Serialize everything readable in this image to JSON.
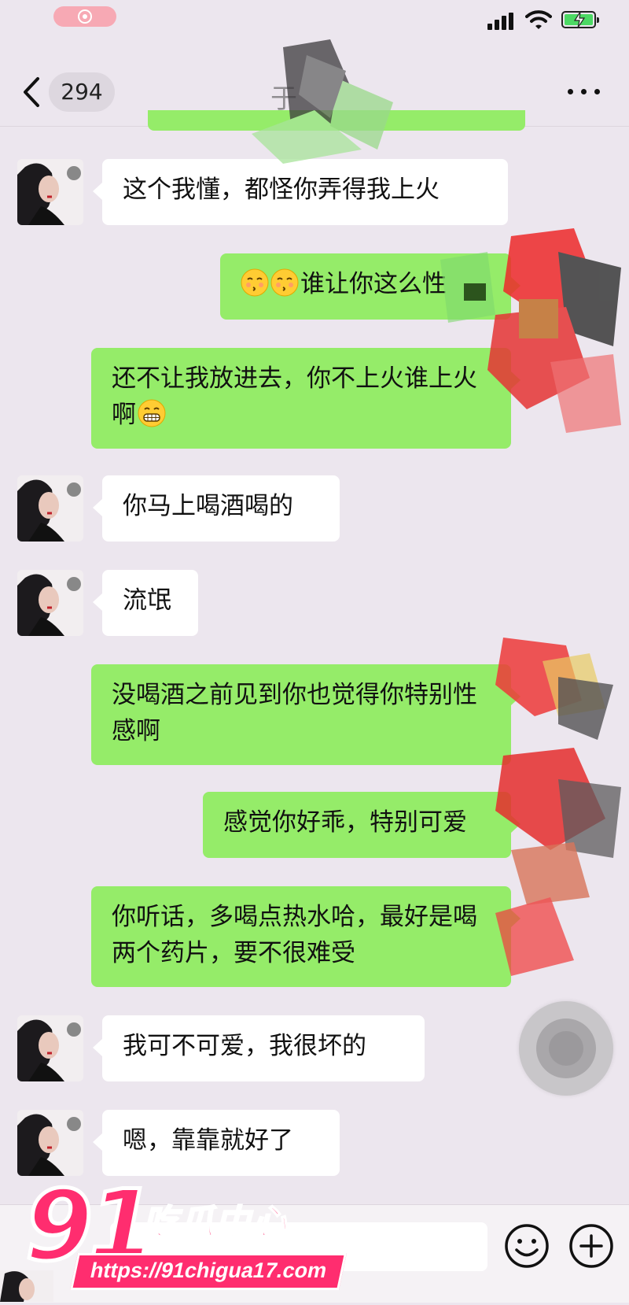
{
  "status_bar": {
    "signal": "signal-icon",
    "wifi": "wifi-icon",
    "battery": "battery-charging-icon",
    "recording": "screen-recording-icon"
  },
  "nav": {
    "back_icon": "chevron-left-icon",
    "unread_count": "294",
    "title": "于",
    "more_icon": "more-dots-icon"
  },
  "messages": [
    {
      "side": "in",
      "text": "这个我懂，都怪你弄得我上火"
    },
    {
      "side": "out",
      "emoji": [
        "kissing-closed-eyes-emoji",
        "kissing-closed-eyes-emoji"
      ],
      "text": "谁让你这么性"
    },
    {
      "side": "out",
      "text": "还不让我放进去，你不上火谁上火啊",
      "emoji_after": "grimacing-emoji"
    },
    {
      "side": "in",
      "text": "你马上喝酒喝的"
    },
    {
      "side": "in",
      "text": "流氓"
    },
    {
      "side": "out",
      "text": "没喝酒之前见到你也觉得你特别性感啊"
    },
    {
      "side": "out",
      "text": "感觉你好乖，特别可爱"
    },
    {
      "side": "out",
      "text": "你听话，多喝点热水哈，最好是喝两个药片，要不很难受"
    },
    {
      "side": "in",
      "text": "我可不可爱，我很坏的"
    },
    {
      "side": "in",
      "text": "嗯，靠靠就好了"
    }
  ],
  "input_bar": {
    "placeholder": "",
    "emoji_icon": "smiley-icon",
    "plus_icon": "plus-circle-icon"
  },
  "floating_window": {
    "icon": "floating-window-icon"
  },
  "watermark": {
    "number": "91",
    "name": "吃瓜中心",
    "url": "https://91chigua17.com"
  },
  "colors": {
    "background": "#ece6ee",
    "outgoing_bubble": "#95ec69",
    "incoming_bubble": "#ffffff",
    "watermark": "#ff2d6f"
  }
}
